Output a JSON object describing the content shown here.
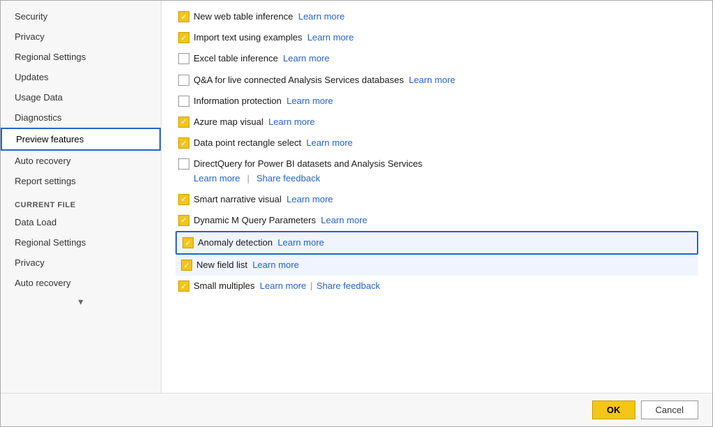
{
  "sidebar": {
    "items": [
      {
        "id": "security",
        "label": "Security",
        "active": false
      },
      {
        "id": "privacy",
        "label": "Privacy",
        "active": false
      },
      {
        "id": "regional-settings",
        "label": "Regional Settings",
        "active": false
      },
      {
        "id": "updates",
        "label": "Updates",
        "active": false
      },
      {
        "id": "usage-data",
        "label": "Usage Data",
        "active": false
      },
      {
        "id": "diagnostics",
        "label": "Diagnostics",
        "active": false
      },
      {
        "id": "preview-features",
        "label": "Preview features",
        "active": true
      },
      {
        "id": "auto-recovery",
        "label": "Auto recovery",
        "active": false
      },
      {
        "id": "report-settings",
        "label": "Report settings",
        "active": false
      }
    ],
    "current_file_section": "CURRENT FILE",
    "current_file_items": [
      {
        "id": "data-load",
        "label": "Data Load"
      },
      {
        "id": "regional-settings-cf",
        "label": "Regional Settings"
      },
      {
        "id": "privacy-cf",
        "label": "Privacy"
      },
      {
        "id": "auto-recovery-cf",
        "label": "Auto recovery"
      }
    ],
    "scroll_down_label": "▾"
  },
  "features": [
    {
      "id": "new-web-table",
      "checked": true,
      "label": "New web table inference",
      "learn_more": true,
      "share_feedback": false,
      "highlighted": false
    },
    {
      "id": "import-text",
      "checked": true,
      "label": "Import text using examples",
      "learn_more": true,
      "share_feedback": false,
      "highlighted": false
    },
    {
      "id": "excel-table",
      "checked": false,
      "label": "Excel table inference",
      "learn_more": true,
      "share_feedback": false,
      "highlighted": false
    },
    {
      "id": "qa-live",
      "checked": false,
      "label": "Q&A for live connected Analysis Services databases",
      "learn_more": true,
      "share_feedback": false,
      "highlighted": false
    },
    {
      "id": "info-protection",
      "checked": false,
      "label": "Information protection",
      "learn_more": true,
      "share_feedback": false,
      "highlighted": false
    },
    {
      "id": "azure-map",
      "checked": true,
      "label": "Azure map visual",
      "learn_more": true,
      "share_feedback": false,
      "highlighted": false
    },
    {
      "id": "data-point-rect",
      "checked": true,
      "label": "Data point rectangle select",
      "learn_more": true,
      "share_feedback": false,
      "highlighted": false
    },
    {
      "id": "directquery",
      "checked": false,
      "label": "DirectQuery for Power BI datasets and Analysis Services",
      "learn_more": true,
      "share_feedback": true,
      "highlighted": false,
      "multiline": true
    },
    {
      "id": "smart-narrative",
      "checked": true,
      "label": "Smart narrative visual",
      "learn_more": true,
      "share_feedback": false,
      "highlighted": false
    },
    {
      "id": "dynamic-m",
      "checked": true,
      "label": "Dynamic M Query Parameters",
      "learn_more": true,
      "share_feedback": false,
      "highlighted": false
    },
    {
      "id": "anomaly-detection",
      "checked": true,
      "label": "Anomaly detection",
      "learn_more": true,
      "share_feedback": false,
      "highlighted": true
    },
    {
      "id": "new-field-list",
      "checked": true,
      "label": "New field list",
      "learn_more": true,
      "share_feedback": false,
      "highlighted": false,
      "dim": true
    },
    {
      "id": "small-multiples",
      "checked": true,
      "label": "Small multiples",
      "learn_more": true,
      "share_feedback": true,
      "highlighted": false
    }
  ],
  "footer": {
    "ok_label": "OK",
    "cancel_label": "Cancel"
  },
  "colors": {
    "accent_blue": "#2563cc",
    "checked_yellow": "#f5c518",
    "ok_button": "#f5c518"
  }
}
